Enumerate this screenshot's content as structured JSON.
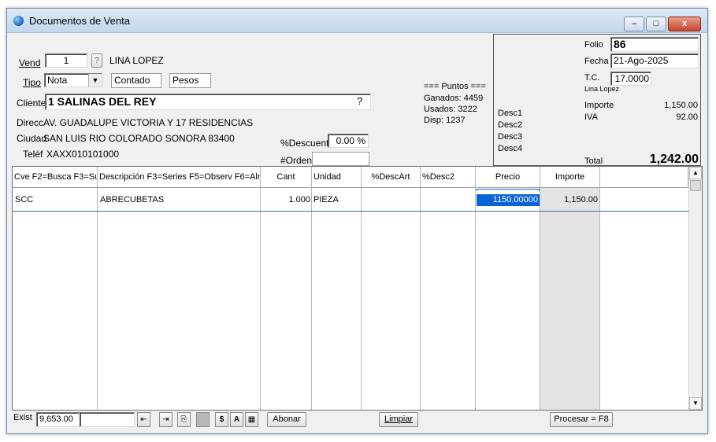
{
  "window": {
    "title": "Documentos de Venta",
    "controls": {
      "minimize": "–",
      "maximize": "□",
      "close": "x"
    }
  },
  "header": {
    "vend_label": "Vend",
    "vend_value": "1",
    "vend_help": "?",
    "vend_name": "LINA LOPEZ",
    "tipo_label": "Tipo",
    "tipo_value": "Nota",
    "contado": "Contado",
    "moneda": "Pesos",
    "cliente_label": "Cliente",
    "cliente_value": "1 SALINAS DEL REY",
    "cliente_help": "?",
    "direcc_label": "Direcc",
    "direcc_value": "AV. GUADALUPE VICTORIA Y 17  RESIDENCIAS",
    "ciudad_label": "Ciudad",
    "ciudad_value": "SAN LUIS RIO COLORADO SONORA 83400",
    "telef_label": "Teléf",
    "telef_value": "XAXX010101000",
    "descuent_label": "%Descuent",
    "descuent_value": "0.00 %",
    "orden_label": "#Orden",
    "orden_value": ""
  },
  "puntos": {
    "title": "=== Puntos ===",
    "ganados": "Ganados: 4459",
    "usados": "Usados: 3222",
    "disp": "Disp: 1237"
  },
  "descuentos": [
    "Desc1",
    "Desc2",
    "Desc3",
    "Desc4"
  ],
  "summary": {
    "folio_label": "Folio",
    "folio_value": "86",
    "fecha_label": "Fecha",
    "fecha_value": "21-Ago-2025",
    "tc_label": "T.C.",
    "tc_value": "17.0000",
    "user": "Lina Lopez",
    "importe_label": "Importe",
    "importe_value": "1,150.00",
    "iva_label": "IVA",
    "iva_value": "92.00",
    "total_label": "Total",
    "total_value": "1,242.00"
  },
  "grid": {
    "columns": [
      "Cve F2=Busca F3=Su",
      "Descripción  F3=Series F5=Observ F6=Aln",
      "Cant",
      "Unidad",
      "%DescArt",
      "%Desc2",
      "Precio",
      "Importe",
      ""
    ],
    "rows": [
      {
        "cve": "SCC",
        "descripcion": "ABRECUBETAS",
        "cant": "1.000",
        "unidad": "PIEZA",
        "descart": "",
        "desc2": "",
        "precio": "1150.00000",
        "importe": "1,150.00",
        "extra": ""
      }
    ]
  },
  "footer": {
    "exist_label": "Exist",
    "exist_value": "9,653.00",
    "exist_extra": "",
    "dollar": "$",
    "letter_a": "A",
    "abonar": "Abonar",
    "limpiar": "Limpiar",
    "procesar": "Procesar = F8"
  },
  "colors": {
    "selection": "#0a64d8",
    "total_band": "#e4e4e4"
  }
}
